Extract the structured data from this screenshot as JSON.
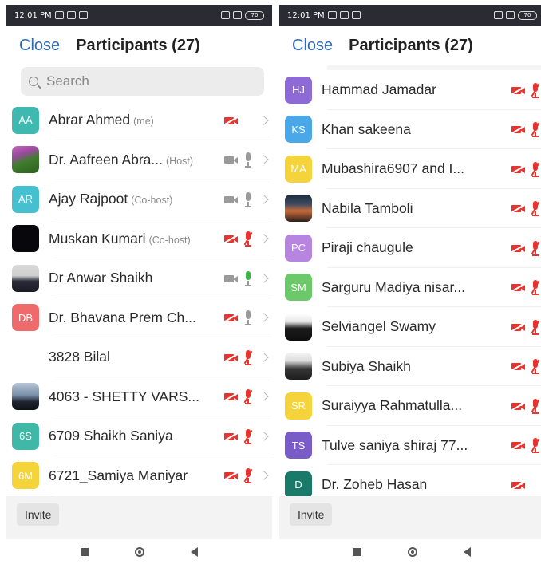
{
  "status": {
    "time": "12:01 PM",
    "battery": "70"
  },
  "header": {
    "close_label": "Close",
    "title": "Participants (27)"
  },
  "search": {
    "placeholder": "Search"
  },
  "footer": {
    "invite_label": "Invite"
  },
  "colors": {
    "accent": "#2f6bb3",
    "muted_red": "#e8332e",
    "talking_green": "#39b54a"
  },
  "left_list": [
    {
      "initials": "AA",
      "avatar_color": "#3fb8b0",
      "name": "Abrar Ahmed",
      "tag": "(me)",
      "video": "off",
      "audio": "none"
    },
    {
      "initials": "",
      "avatar_photo": "photo-flower",
      "name": "Dr. Aafreen Abra...",
      "tag": "(Host)",
      "video": "on",
      "audio": "on"
    },
    {
      "initials": "AR",
      "avatar_color": "#46c0cf",
      "name": "Ajay Rajpoot",
      "tag": "(Co-host)",
      "video": "on",
      "audio": "on"
    },
    {
      "initials": "",
      "avatar_photo": "photo-dark",
      "name": "Muskan Kumari",
      "tag": "(Co-host)",
      "video": "off",
      "audio": "muted"
    },
    {
      "initials": "",
      "avatar_photo": "photo-man",
      "name": "Dr Anwar Shaikh",
      "tag": "",
      "video": "on",
      "audio": "talking"
    },
    {
      "initials": "DB",
      "avatar_color": "#ef6b6b",
      "name": "Dr. Bhavana Prem Ch...",
      "tag": "",
      "video": "off",
      "audio": "on"
    },
    {
      "initials": "",
      "avatar_photo": "photo-blank",
      "name": "3828 Bilal",
      "tag": "",
      "video": "off",
      "audio": "muted"
    },
    {
      "initials": "",
      "avatar_photo": "photo-bus",
      "name": "4063 - SHETTY VARS...",
      "tag": "",
      "video": "off",
      "audio": "muted"
    },
    {
      "initials": "6S",
      "avatar_color": "#3fb8a8",
      "name": "6709 Shaikh Saniya",
      "tag": "",
      "video": "off",
      "audio": "muted"
    },
    {
      "initials": "6M",
      "avatar_color": "#f5d33a",
      "name": "6721_Samiya Maniyar",
      "tag": "",
      "video": "off",
      "audio": "muted"
    }
  ],
  "right_list": [
    {
      "initials": "HJ",
      "avatar_color": "#8e6ad6",
      "name": "Hammad Jamadar",
      "video": "off",
      "audio": "muted"
    },
    {
      "initials": "KS",
      "avatar_color": "#4aa8e8",
      "name": "Khan sakeena",
      "video": "off",
      "audio": "muted"
    },
    {
      "initials": "MA",
      "avatar_color": "#f5d33a",
      "name": "Mubashira6907 and I...",
      "video": "off",
      "audio": "muted"
    },
    {
      "initials": "",
      "avatar_photo": "photo-sunset",
      "name": "Nabila Tamboli",
      "video": "off",
      "audio": "muted"
    },
    {
      "initials": "PC",
      "avatar_color": "#b784e0",
      "name": "Piraji chaugule",
      "video": "off",
      "audio": "muted"
    },
    {
      "initials": "SM",
      "avatar_color": "#6cc96a",
      "name": "Sarguru Madiya nisar...",
      "video": "off",
      "audio": "muted"
    },
    {
      "initials": "",
      "avatar_photo": "photo-girl",
      "name": "Selviangel Swamy",
      "video": "off",
      "audio": "muted"
    },
    {
      "initials": "",
      "avatar_photo": "photo-hijab",
      "name": "Subiya Shaikh",
      "video": "off",
      "audio": "muted"
    },
    {
      "initials": "SR",
      "avatar_color": "#f5d33a",
      "name": "Suraiyya Rahmatulla...",
      "video": "off",
      "audio": "muted"
    },
    {
      "initials": "TS",
      "avatar_color": "#7a5cc8",
      "name": "Tulve saniya shiraj 77...",
      "video": "off",
      "audio": "muted"
    },
    {
      "initials": "D",
      "avatar_color": "#1a7a6a",
      "name": "Dr. Zoheb Hasan",
      "video": "off",
      "audio": "none"
    }
  ]
}
